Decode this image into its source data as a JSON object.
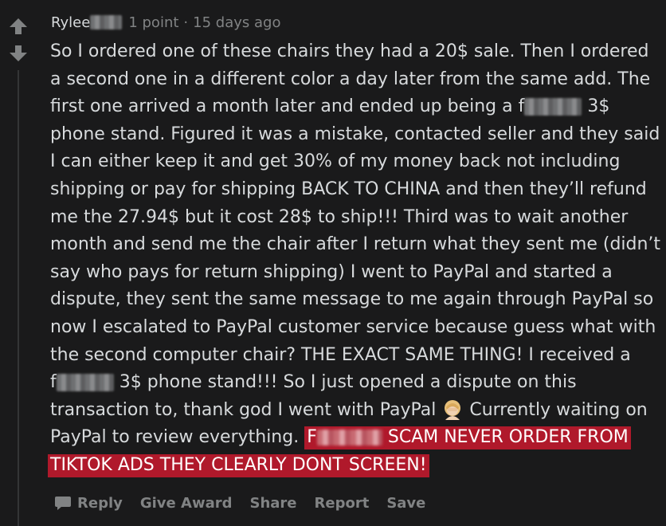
{
  "comment": {
    "author": "Rylee",
    "score": "1 point",
    "separator": "·",
    "age": "15 days ago",
    "lines": [
      "So I ordered one of these chairs they had a 20$ sale. Then I ordered",
      "a second one in a different color a day later from the same add. The",
      "phone stand. Figured it was a mistake, contacted seller and they said",
      "I can either keep it and get 30% of my money back not including",
      "shipping or pay for shipping BACK TO CHINA and then they’ll refund",
      "me the 27.94$ but it cost 28$ to ship!!! Third was to wait another",
      "month and send me the chair after I return what they sent me (didn’t",
      "say who pays for return shipping) I went to PayPal and started a",
      "dispute, they sent the same message to me again through PayPal so",
      "now I escalated to PayPal customer service because guess what with",
      "the second computer chair? THE EXACT SAME THING! I received a"
    ],
    "line3_start": "first one arrived a month later and ended up being a f",
    "line3_end": " 3$",
    "line12_start": "f",
    "line12_end": " 3$ phone stand!!! So I just opened a dispute on this",
    "line13_start": "transaction to, thank god I went with PayPal",
    "line13_end": " Currently waiting on",
    "line14_start": "PayPal to review everything. ",
    "highlight_start": "F",
    "highlight_end": " SCAM NEVER ORDER FROM",
    "highlight_line2": "TIKTOK ADS THEY CLEARLY DONT SCREEN!",
    "emoji": "woman-facepalming-emoji"
  },
  "actions": {
    "reply": "Reply",
    "give_award": "Give Award",
    "share": "Share",
    "report": "Report",
    "save": "Save"
  },
  "colors": {
    "background": "#1a1a1b",
    "text": "#d7dadc",
    "muted": "#818384",
    "highlight": "#b0192b"
  }
}
